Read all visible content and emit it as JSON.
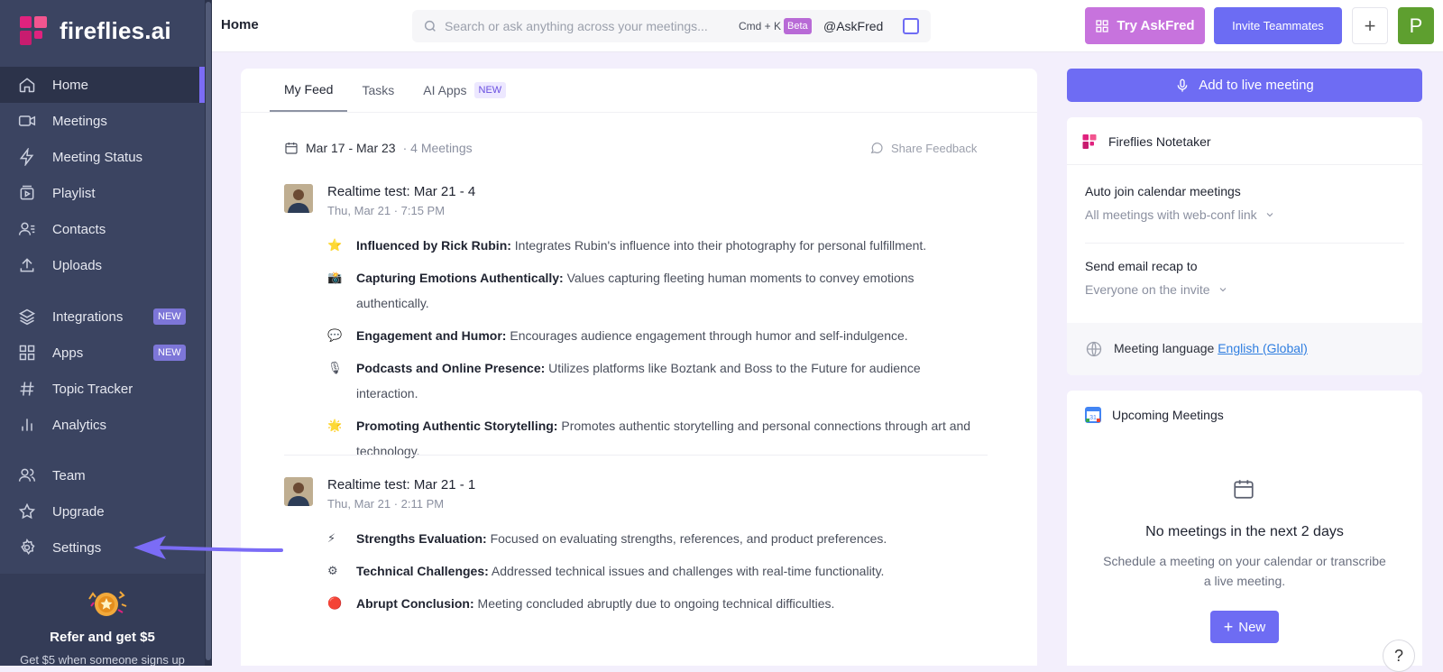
{
  "brand": {
    "name": "fireflies.ai",
    "accent": "#6e6cf3",
    "pink": "#e0227e"
  },
  "sidebar": {
    "items": [
      {
        "label": "Home",
        "icon": "home-icon",
        "active": true
      },
      {
        "label": "Meetings",
        "icon": "video-icon"
      },
      {
        "label": "Meeting Status",
        "icon": "bolt-icon"
      },
      {
        "label": "Playlist",
        "icon": "playlist-icon"
      },
      {
        "label": "Contacts",
        "icon": "contacts-icon"
      },
      {
        "label": "Uploads",
        "icon": "upload-icon"
      },
      {
        "label": "Integrations",
        "icon": "layers-icon",
        "badge": "NEW"
      },
      {
        "label": "Apps",
        "icon": "grid-icon",
        "badge": "NEW"
      },
      {
        "label": "Topic Tracker",
        "icon": "hash-icon"
      },
      {
        "label": "Analytics",
        "icon": "analytics-icon"
      },
      {
        "label": "Team",
        "icon": "team-icon"
      },
      {
        "label": "Upgrade",
        "icon": "star-icon"
      },
      {
        "label": "Settings",
        "icon": "gear-icon"
      }
    ],
    "refer": {
      "title": "Refer and get $5",
      "subtitle": "Get $5 when someone signs up"
    }
  },
  "topbar": {
    "page_title": "Home",
    "search_placeholder": "Search or ask anything across your meetings...",
    "shortcut": "Cmd + K",
    "beta": "Beta",
    "askfred": "@AskFred",
    "try_button": "Try AskFred",
    "invite_button": "Invite Teammates",
    "plus": "+",
    "avatar_initial": "P"
  },
  "feed": {
    "tabs": [
      {
        "label": "My Feed",
        "active": true
      },
      {
        "label": "Tasks"
      },
      {
        "label": "AI Apps",
        "badge": "NEW"
      }
    ],
    "date_range": "Mar 17 - Mar 23",
    "meeting_count": "· 4 Meetings",
    "feedback": "Share Feedback",
    "meetings": [
      {
        "title": "Realtime test: Mar 21 - 4",
        "time": "Thu, Mar 21 · 7:15 PM",
        "bullets": [
          {
            "emoji": "⭐",
            "heading": "Influenced by Rick Rubin:",
            "text": " Integrates Rubin's influence into their photography for personal fulfillment."
          },
          {
            "emoji": "📸",
            "heading": "Capturing Emotions Authentically:",
            "text": " Values capturing fleeting human moments to convey emotions authentically."
          },
          {
            "emoji": "💬",
            "heading": "Engagement and Humor:",
            "text": " Encourages audience engagement through humor and self-indulgence."
          },
          {
            "emoji": "🎙",
            "heading": "Podcasts and Online Presence:",
            "text": " Utilizes platforms like Boztank and Boss to the Future for audience interaction."
          },
          {
            "emoji": "🌟",
            "heading": "Promoting Authentic Storytelling:",
            "text": " Promotes authentic storytelling and personal connections through art and technology."
          }
        ]
      },
      {
        "title": "Realtime test: Mar 21 - 1",
        "time": "Thu, Mar 21 · 2:11 PM",
        "bullets": [
          {
            "emoji": "⚡",
            "heading": "Strengths Evaluation:",
            "text": " Focused on evaluating strengths, references, and product preferences."
          },
          {
            "emoji": "⚙",
            "heading": "Technical Challenges:",
            "text": " Addressed technical issues and challenges with real-time functionality."
          },
          {
            "emoji": "🔴",
            "heading": "Abrupt Conclusion:",
            "text": " Meeting concluded abruptly due to ongoing technical difficulties."
          }
        ]
      }
    ]
  },
  "right": {
    "live_button": "Add to live meeting",
    "notetaker": {
      "title": "Fireflies Notetaker",
      "auto_join_label": "Auto join calendar meetings",
      "auto_join_value": "All meetings with web-conf link",
      "email_label": "Send email recap to",
      "email_value": "Everyone on the invite",
      "language_label": "Meeting language",
      "language_value": "English (Global)"
    },
    "upcoming": {
      "title": "Upcoming Meetings",
      "empty_title": "No meetings in the next 2 days",
      "empty_sub": "Schedule a meeting on your calendar or transcribe a live meeting.",
      "new_button": "New",
      "calendar_day": "31"
    },
    "help": "?"
  }
}
